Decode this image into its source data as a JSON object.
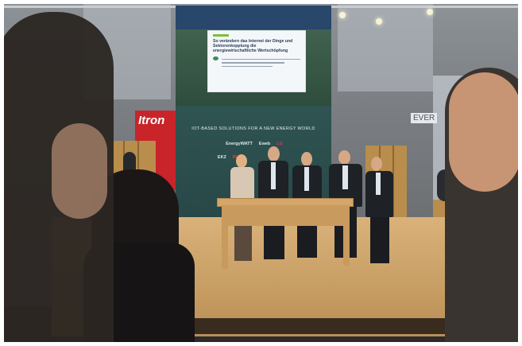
{
  "photo": {
    "description_tag": "trade-fair stage panel discussion",
    "screen": {
      "slide_title": "So verändern das Internet der Dinge und Sektorenkopplung die energiewirtschaftliche Wertschöpfung"
    },
    "wall": {
      "tagline": "IOT-BASED SOLUTIONS FOR A NEW ENERGY WORLD",
      "logos": [
        "EnergyWATT",
        "Eweb",
        "LG",
        "EKZ",
        "BKW"
      ]
    },
    "signs": {
      "itron": "Itron",
      "right": "EVER"
    },
    "colors": {
      "wall_green": "#41624f",
      "wall_panel": "#2f5452",
      "itron_red": "#c8242a",
      "stage_wood": "#d9b27a"
    }
  }
}
